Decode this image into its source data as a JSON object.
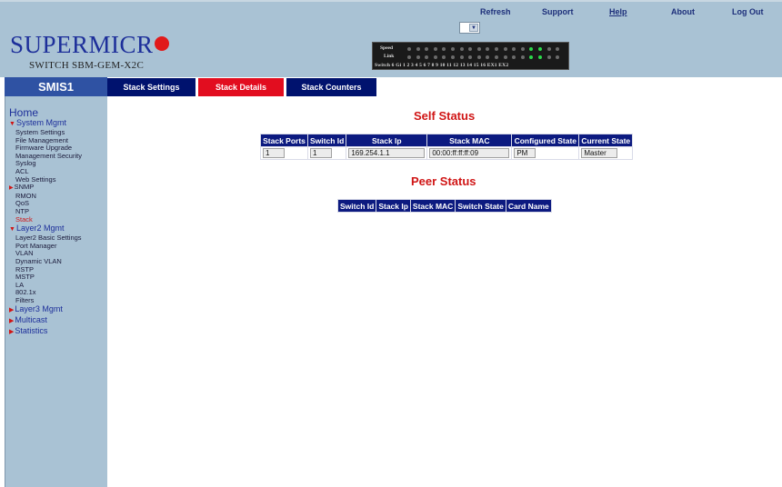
{
  "header": {
    "brand": "SUPERMICR",
    "subtitle": "SWITCH SBM-GEM-X2C",
    "links": [
      "Refresh",
      "Support",
      "Help",
      "About",
      "Log Out"
    ],
    "port_panel": {
      "speed_label": "Speed",
      "link_label": "Link",
      "switch_label": "Switch 6 Gi",
      "port_numbers": "1 2 3 4 5 6 7 8 9 10 11 12 13 14 15 16 EX1 EX2"
    }
  },
  "sidebar": {
    "title": "SMIS1",
    "home": "Home",
    "sections": [
      {
        "label": "System Mgmt",
        "expanded": true,
        "items": [
          "System Settings",
          "File Management",
          "Firmware Upgrade",
          "Management Security",
          "Syslog",
          "ACL",
          "Web Settings",
          "SNMP",
          "RMON",
          "QoS",
          "NTP",
          "Stack"
        ]
      },
      {
        "label": "Layer2 Mgmt",
        "expanded": true,
        "items": [
          "Layer2 Basic Settings",
          "Port Manager",
          "VLAN",
          "Dynamic VLAN",
          "RSTP",
          "MSTP",
          "LA",
          "802.1x",
          "Filters"
        ]
      },
      {
        "label": "Layer3 Mgmt",
        "expanded": false
      },
      {
        "label": "Multicast",
        "expanded": false
      },
      {
        "label": "Statistics",
        "expanded": false
      }
    ]
  },
  "tabs": [
    "Stack Settings",
    "Stack Details",
    "Stack Counters"
  ],
  "self_status": {
    "title": "Self Status",
    "columns": [
      "Stack Ports",
      "Switch Id",
      "Stack Ip",
      "Stack MAC",
      "Configured State",
      "Current State"
    ],
    "row": [
      "1",
      "1",
      "169.254.1.1",
      "00:00:ff:ff:ff:09",
      "PM",
      "Master"
    ]
  },
  "peer_status": {
    "title": "Peer Status",
    "columns": [
      "Switch Id",
      "Stack Ip",
      "Stack MAC",
      "Switch State",
      "Card Name"
    ]
  },
  "colors": {
    "header_bg": "#a9c2d4",
    "tab_bg": "#00126e",
    "tab_active_bg": "#e20d1f",
    "accent_red": "#d01515",
    "table_header_bg": "#0c1a80"
  }
}
